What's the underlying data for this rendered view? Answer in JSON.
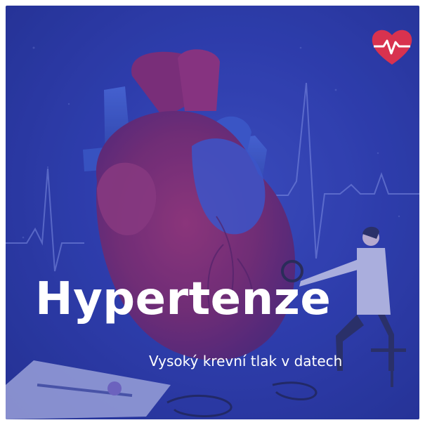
{
  "title": "Hypertenze",
  "subtitle": "Vysoký krevní tlak v datech",
  "icons": {
    "logo": "heart-pulse-icon"
  },
  "colors": {
    "background": "#2f3fae",
    "heart_red": "#8a2a66",
    "heart_blue": "#3a56c8",
    "logo_red": "#d8324f",
    "text": "#ffffff"
  }
}
